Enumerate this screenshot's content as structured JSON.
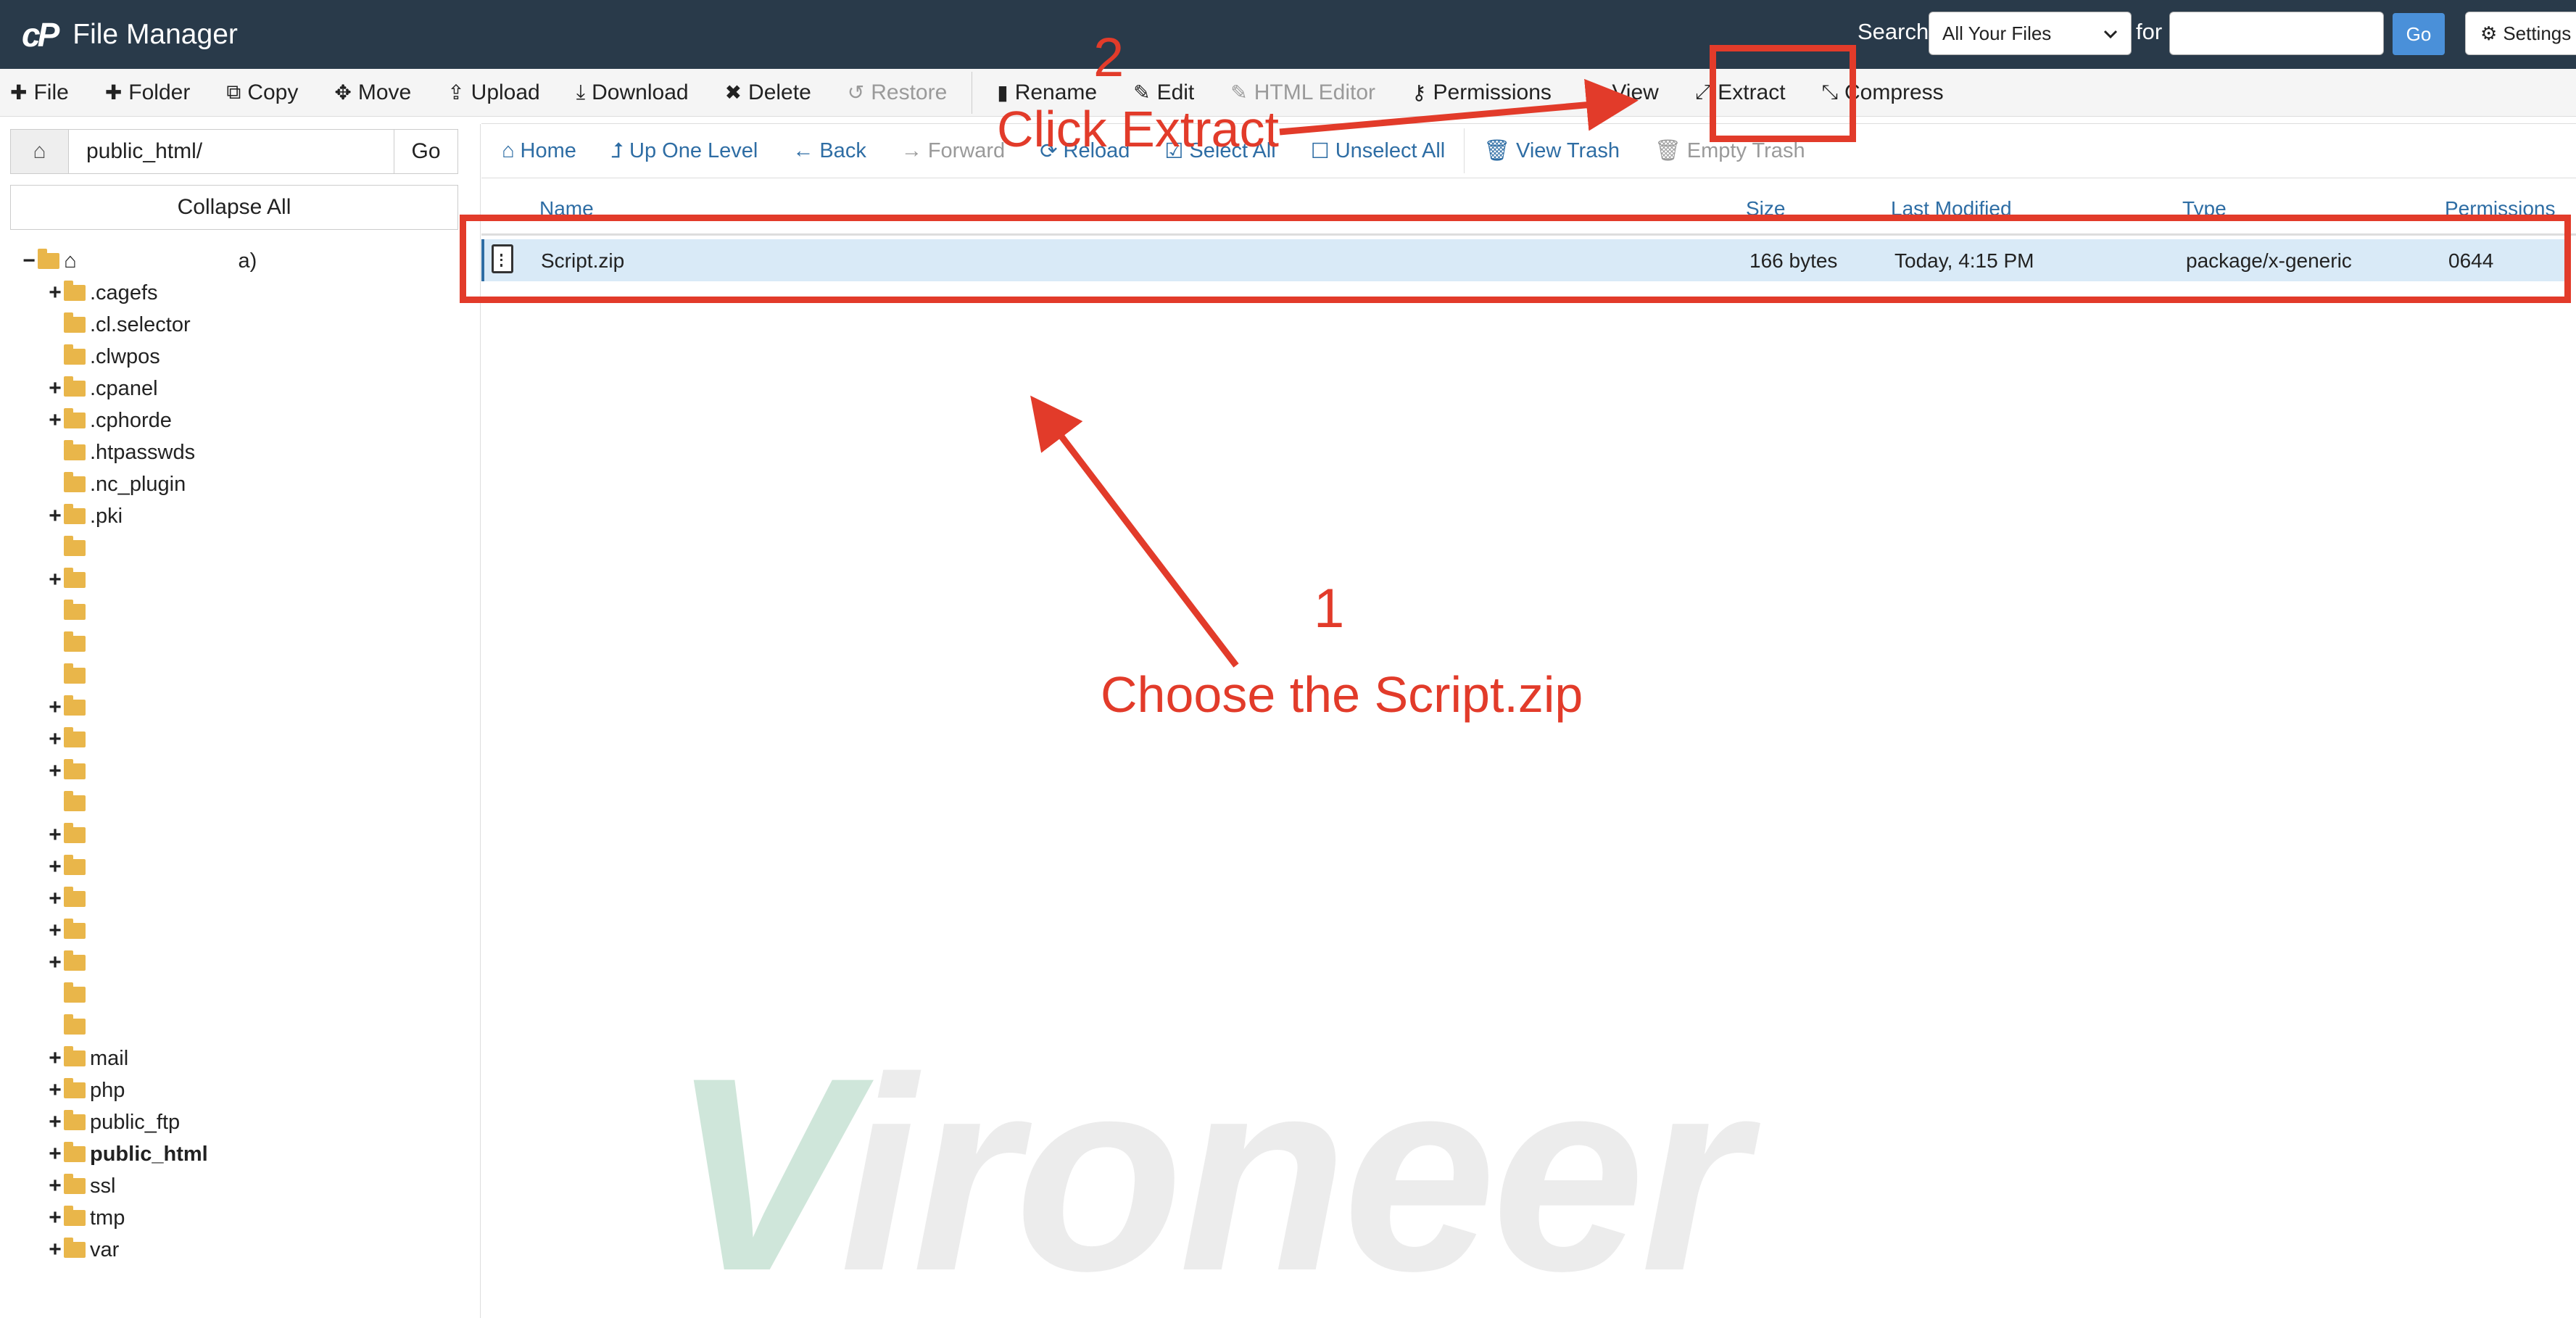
{
  "header": {
    "app_title": "File Manager",
    "search_label": "Search",
    "search_scope": "All Your Files",
    "for_label": "for",
    "search_placeholder": "",
    "go_label": "Go",
    "settings_label": "Settings"
  },
  "toolbar": {
    "file": "File",
    "folder": "Folder",
    "copy": "Copy",
    "move": "Move",
    "upload": "Upload",
    "download": "Download",
    "delete": "Delete",
    "restore": "Restore",
    "rename": "Rename",
    "edit": "Edit",
    "html_editor": "HTML Editor",
    "permissions": "Permissions",
    "view": "View",
    "extract": "Extract",
    "compress": "Compress"
  },
  "path_bar": {
    "value": "public_html/",
    "go_label": "Go"
  },
  "collapse_all": "Collapse All",
  "tree": {
    "root_suffix": "a)",
    "items": [
      ".cagefs",
      ".cl.selector",
      ".clwpos",
      ".cpanel",
      ".cphorde",
      ".htpasswds",
      ".nc_plugin",
      ".pki",
      "mail",
      "php",
      "public_ftp",
      "public_html",
      "ssl",
      "tmp",
      "var"
    ]
  },
  "nav": {
    "home": "Home",
    "up_one_level": "Up One Level",
    "back": "Back",
    "forward": "Forward",
    "reload": "Reload",
    "select_all": "Select All",
    "unselect_all": "Unselect All",
    "view_trash": "View Trash",
    "empty_trash": "Empty Trash"
  },
  "table": {
    "columns": [
      "Name",
      "Size",
      "Last Modified",
      "Type",
      "Permissions"
    ],
    "rows": [
      {
        "name": "Script.zip",
        "size": "166 bytes",
        "modified": "Today, 4:15 PM",
        "type": "package/x-generic",
        "perms": "0644"
      }
    ]
  },
  "annotations": {
    "step1_number": "1",
    "step1_text": "Choose the Script.zip",
    "step2_number": "2",
    "step2_text": "Click Extract",
    "color": "#e23b2a"
  },
  "watermark": {
    "first": "V",
    "rest": "ironeer"
  },
  "colors": {
    "header_bg": "#293a4a",
    "link": "#2e6da4",
    "selected_row": "#d9eaf7",
    "folder": "#e9b64a"
  }
}
